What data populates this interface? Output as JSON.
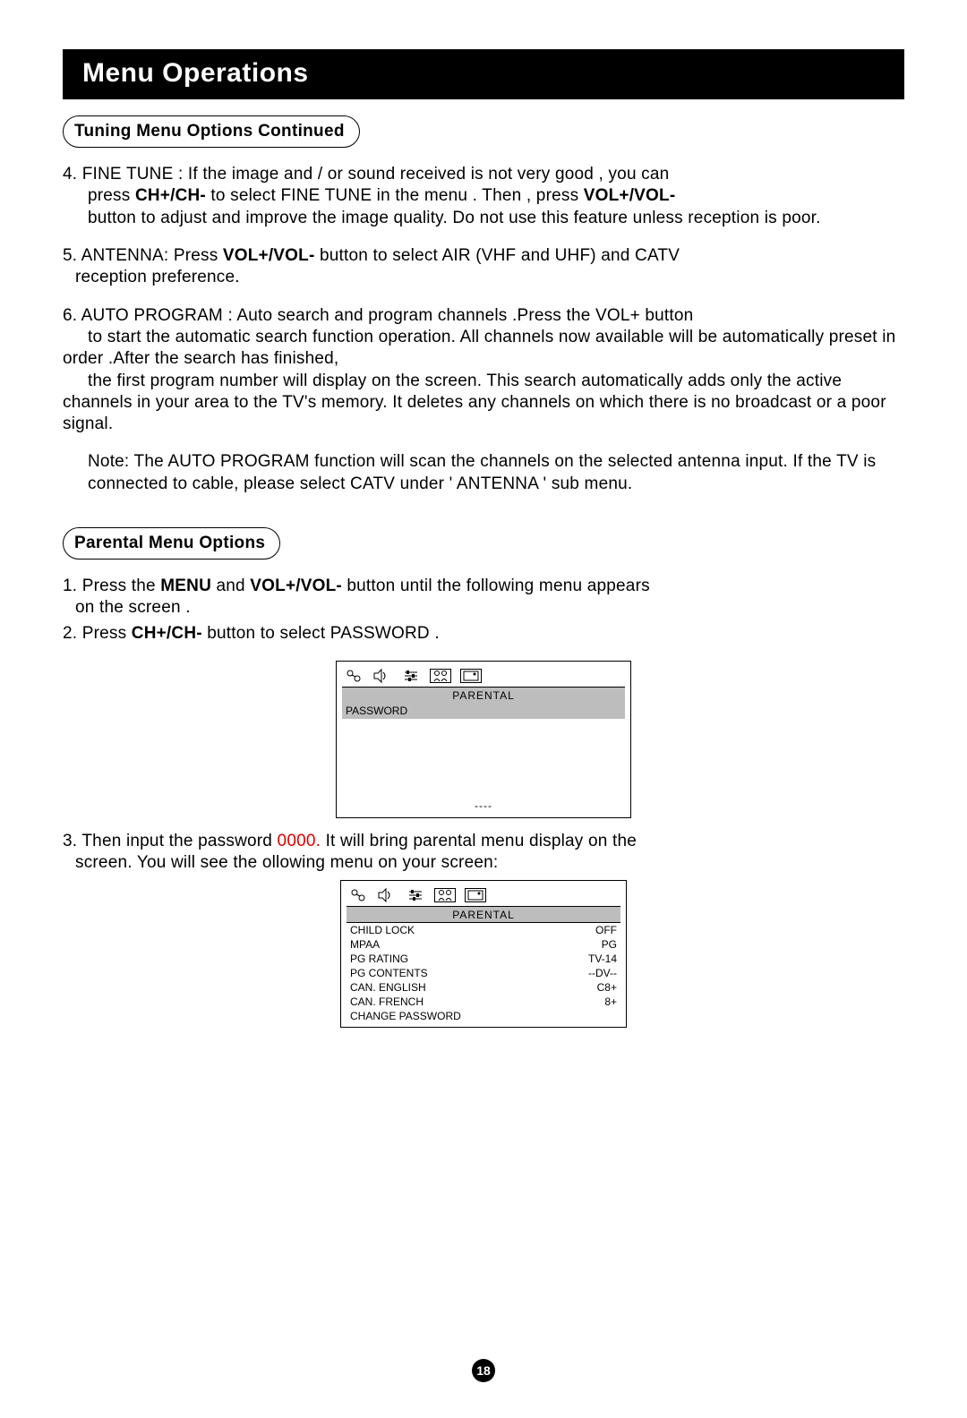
{
  "title": "Menu Operations",
  "sections": {
    "tuning_heading": "Tuning Menu Options Continued",
    "parental_heading": "Parental Menu Options"
  },
  "tuning": {
    "item4_a": "4. FINE TUNE : If the image and / or sound received is not very good , you can",
    "item4_b": "press ",
    "item4_b_bold": "CH+/CH-",
    "item4_b2": " to select FINE TUNE in the menu . Then , press ",
    "item4_b_bold2": "VOL+/VOL-",
    "item4_c": "button to adjust and improve the image quality. Do not use this feature unless reception is poor.",
    "item5_a": "5. ANTENNA: Press ",
    "item5_bold": "VOL+/VOL-",
    "item5_b": " button to select AIR (VHF and UHF) and CATV",
    "item5_c": "reception preference.",
    "item6_a": "6. AUTO PROGRAM : Auto search and program channels .Press the VOL+ button",
    "item6_b": "to start the automatic search function operation. All channels now available will be automatically preset in order .After the search has finished,",
    "item6_c": "the first program number will display on the screen. This search automatically adds only the active channels in your area to the TV's memory. It deletes any channels on which there is no broadcast or a poor signal.",
    "note": "Note: The AUTO PROGRAM function will scan the channels on the selected antenna input.  If the TV is connected to cable, please select CATV under ' ANTENNA ' sub menu."
  },
  "parental": {
    "item1_a": "1. Press the ",
    "item1_bold1": "MENU",
    "item1_mid": " and ",
    "item1_bold2": "VOL+/VOL-",
    "item1_b": " button until the following menu appears",
    "item1_c": "on the screen .",
    "item2_a": "2. Press ",
    "item2_bold": "CH+/CH-",
    "item2_b": " button to select PASSWORD .",
    "item3_a": "3. Then input the password ",
    "item3_red": "0000.",
    "item3_b": " It will bring parental menu display on  the",
    "item3_c": "screen. You will see the ollowing menu on your screen:"
  },
  "osd1": {
    "header": "PARENTAL",
    "row": "PASSWORD",
    "blank": "----"
  },
  "osd2": {
    "header": "PARENTAL",
    "items": [
      {
        "label": "CHILD LOCK",
        "value": "OFF"
      },
      {
        "label": "MPAA",
        "value": "PG"
      },
      {
        "label": "PG RATING",
        "value": "TV-14"
      },
      {
        "label": "PG CONTENTS",
        "value": "--DV--"
      },
      {
        "label": "CAN. ENGLISH",
        "value": "C8+"
      },
      {
        "label": "CAN. FRENCH",
        "value": "8+"
      },
      {
        "label": "CHANGE PASSWORD",
        "value": ""
      }
    ]
  },
  "page_number": "18"
}
